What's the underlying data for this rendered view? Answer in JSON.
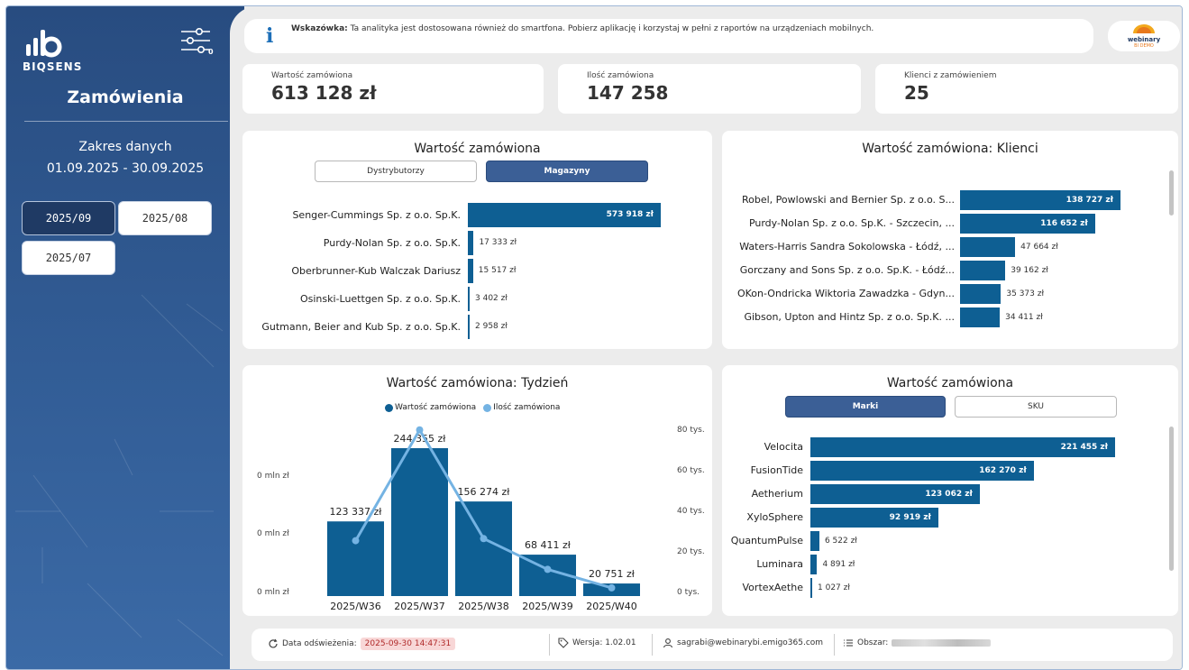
{
  "sidebar": {
    "brand": "BIQSENS",
    "filter_count": "0",
    "page_title": "Zamówienia",
    "range_label": "Zakres danych",
    "range_value": "01.09.2025 - 30.09.2025",
    "periods": [
      {
        "label": "2025/09",
        "active": true
      },
      {
        "label": "2025/08",
        "active": false
      },
      {
        "label": "2025/07",
        "active": false
      }
    ]
  },
  "tip": {
    "bold": "Wskazówka:",
    "text": "Ta analityka jest dostosowana również do smartfona. Pobierz aplikację i korzystaj w pełni z raportów na urządzeniach mobilnych.",
    "badge_line1": "webinary",
    "badge_line2": "BI DEMO"
  },
  "kpis": [
    {
      "label": "Wartość zamówiona",
      "value": "613 128 zł"
    },
    {
      "label": "Ilość zamówiona",
      "value": "147 258"
    },
    {
      "label": "Klienci z zamówieniem",
      "value": "25"
    }
  ],
  "distributors_chart": {
    "title": "Wartość zamówiona",
    "toggles": [
      {
        "label": "Dystrybutorzy",
        "active": false
      },
      {
        "label": "Magazyny",
        "active": true
      }
    ]
  },
  "clients_chart": {
    "title": "Wartość zamówiona: Klienci"
  },
  "weekly_chart": {
    "title": "Wartość zamówiona: Tydzień",
    "legend": [
      {
        "label": "Wartość zamówiona",
        "color": "#0e5f93"
      },
      {
        "label": "Ilość zamówiona",
        "color": "#74b3e3"
      }
    ],
    "left_ticks": [
      "0 mln zł",
      "0 mln zł",
      "0 mln zł"
    ],
    "right_ticks": [
      "80 tys.",
      "60 tys.",
      "40 tys.",
      "20 tys.",
      "0 tys."
    ]
  },
  "brands_chart": {
    "title": "Wartość zamówiona",
    "toggles": [
      {
        "label": "Marki",
        "active": true
      },
      {
        "label": "SKU",
        "active": false
      }
    ]
  },
  "footer": {
    "refresh_label": "Data odświeżenia:",
    "refresh_value": "2025-09-30 14:47:31",
    "version": "Wersja: 1.02.01",
    "user": "sagrabi@webinarybi.emigo365.com",
    "area_label": "Obszar:"
  },
  "colors": {
    "bar": "#0e5f93",
    "line": "#74b3e3",
    "sidebar": "#284c80",
    "accent": "#3b5f96"
  },
  "chart_data": [
    {
      "type": "bar",
      "orientation": "horizontal",
      "title": "Wartość zamówiona",
      "categories": [
        "Senger-Cummings Sp. z o.o. Sp.K.",
        "Purdy-Nolan Sp. z o.o. Sp.K.",
        "Oberbrunner-Kub Walczak Dariusz",
        "Osinski-Luettgen Sp. z o.o. Sp.K.",
        "Gutmann, Beier and Kub Sp. z o.o. Sp.K."
      ],
      "values": [
        573918,
        17333,
        15517,
        3402,
        2958
      ],
      "labels": [
        "573 918 zł",
        "17 333 zł",
        "15 517 zł",
        "3 402 zł",
        "2 958 zł"
      ]
    },
    {
      "type": "bar",
      "orientation": "horizontal",
      "title": "Wartość zamówiona: Klienci",
      "categories": [
        "Robel, Powlowski and Bernier Sp. z o.o. S...",
        "Purdy-Nolan Sp. z o.o. Sp.K. - Szczecin, ...",
        "Waters-Harris Sandra Sokolowska - Łódź, ...",
        "Gorczany and Sons Sp. z o.o. Sp.K. - Łódź...",
        "OKon-Ondricka Wiktoria Zawadzka - Gdyn...",
        "Gibson, Upton and Hintz Sp. z o.o. Sp.K. ..."
      ],
      "values": [
        138727,
        116652,
        47664,
        39162,
        35373,
        34411
      ],
      "labels": [
        "138 727 zł",
        "116 652 zł",
        "47 664 zł",
        "39 162 zł",
        "35 373 zł",
        "34 411 zł"
      ]
    },
    {
      "type": "bar",
      "title": "Wartość zamówiona: Tydzień",
      "categories": [
        "2025/W36",
        "2025/W37",
        "2025/W38",
        "2025/W39",
        "2025/W40"
      ],
      "series": [
        {
          "name": "Wartość zamówiona",
          "type": "bar",
          "values": [
            123337,
            244355,
            156274,
            68411,
            20751
          ],
          "labels": [
            "123 337 zł",
            "244 355 zł",
            "156 274 zł",
            "68 411 zł",
            "20 751 zł"
          ]
        },
        {
          "name": "Ilość zamówiona",
          "type": "line",
          "axis": "right",
          "values": [
            27000,
            81000,
            28000,
            13000,
            4000
          ]
        }
      ],
      "y2lim": [
        0,
        80000
      ]
    },
    {
      "type": "bar",
      "orientation": "horizontal",
      "title": "Wartość zamówiona",
      "categories": [
        "Velocita",
        "FusionTide",
        "Aetherium",
        "XyloSphere",
        "QuantumPulse",
        "Luminara",
        "VortexAethe"
      ],
      "values": [
        221455,
        162270,
        123062,
        92919,
        6522,
        4891,
        1027
      ],
      "labels": [
        "221 455 zł",
        "162 270 zł",
        "123 062 zł",
        "92 919 zł",
        "6 522 zł",
        "4 891 zł",
        "1 027 zł"
      ]
    }
  ]
}
